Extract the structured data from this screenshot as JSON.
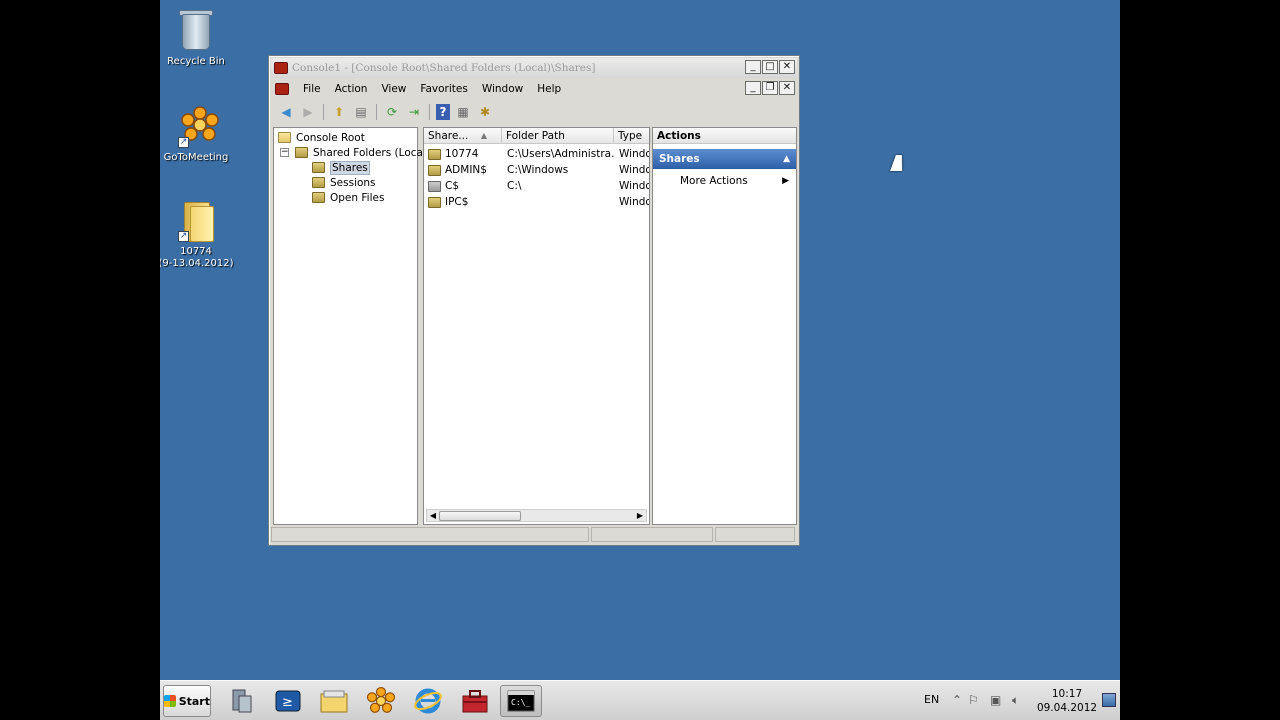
{
  "desktop": {
    "icons": [
      {
        "label": "Recycle Bin",
        "icon": "recycle-bin-icon"
      },
      {
        "label": "GoToMeeting",
        "icon": "gotomeeting-icon"
      },
      {
        "label": "10774",
        "label2": "(9-13.04.2012)",
        "icon": "folder-icon"
      }
    ]
  },
  "window": {
    "title": "Console1 - [Console Root\\Shared Folders (Local)\\Shares]",
    "menu": [
      "File",
      "Action",
      "View",
      "Favorites",
      "Window",
      "Help"
    ],
    "tree": {
      "root": "Console Root",
      "node": "Shared Folders (Local)",
      "children": [
        "Shares",
        "Sessions",
        "Open Files"
      ]
    },
    "list": {
      "columns": [
        "Share...",
        "Folder Path",
        "Type"
      ],
      "rows": [
        {
          "name": "10774",
          "path": "C:\\Users\\Administra...",
          "type": "Windo"
        },
        {
          "name": "ADMIN$",
          "path": "C:\\Windows",
          "type": "Windo"
        },
        {
          "name": "C$",
          "path": "C:\\",
          "type": "Windo"
        },
        {
          "name": "IPC$",
          "path": "",
          "type": "Windo"
        }
      ]
    },
    "actions": {
      "header": "Actions",
      "section": "Shares",
      "items": [
        "More Actions"
      ]
    }
  },
  "taskbar": {
    "start": "Start",
    "language": "EN",
    "time": "10:17",
    "date": "09.04.2012"
  }
}
